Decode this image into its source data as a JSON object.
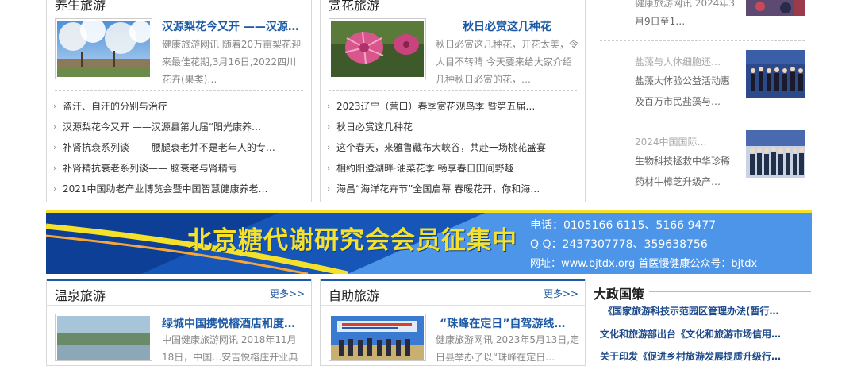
{
  "left_top": {
    "title": "养生旅游",
    "feature": {
      "title": "汉源梨花今又开 ——汉源…",
      "desc": "健康旅游网讯 随着20万亩梨花迎来最佳花期,3月16日,2022四川花卉(果类)…"
    },
    "list": [
      "盗汗、自汗的分别与治疗",
      "汉源梨花今又开 ——汉源县第九届“阳光康养…",
      "补肾抗衰系列谈—— 腰腿衰老并不是老年人的专…",
      "补肾精抗衰老系列谈—— 脑衰老与肾精亏",
      "2021中国助老产业博览会暨中国智慧健康养老…"
    ]
  },
  "mid_top": {
    "title": "赏花旅游",
    "feature": {
      "title": "秋日必赏这几种花",
      "desc": "秋日必赏这几种花，开花太美，令人目不转睛 今天要来给大家介绍几种秋日必赏的花，…"
    },
    "list": [
      "2023辽宁（营口）春季赏花观鸟季 暨第五届…",
      "秋日必赏这几种花",
      "这个春天，来雅鲁藏布大峡谷，共赴一场桃花盛宴",
      "相约阳澄湖畔·油菜花季 畅享春日田间野趣",
      "海昌“海洋花卉节”全国启幕 春暖花开，你和海…"
    ]
  },
  "right_col": {
    "top_text_1": "健康旅游网讯 2024年3",
    "top_text_2": "月9日至1…",
    "items": [
      {
        "gray": "盐藻与人体细胞还…",
        "line1": "盐藻大体验公益活动惠",
        "line2": "及百万市民盐藻与…"
      },
      {
        "gray": "2024中国国际…",
        "line1": "生物科技拯救中华珍稀",
        "line2": "药材牛樟芝升级产…"
      }
    ]
  },
  "banner": {
    "headline": "北京糖代谢研究会会员征集中",
    "phone": "电话：0105166 6115、5166 9477",
    "qq": "Q Q：2437307778、359638756",
    "web": "网址：www.bjtdx.org  首医慢健康公众号：bjtdx"
  },
  "left_bottom": {
    "title": "温泉旅游",
    "more": "更多>>",
    "feature": {
      "title": "绿城中国携悦榕酒店和度…",
      "desc": "中国健康旅游网讯 2018年11月18日，中国…安吉悦榕庄开业典礼及…"
    }
  },
  "mid_bottom": {
    "title": "自助旅游",
    "more": "更多>>",
    "feature": {
      "title": "“珠峰在定日”自驾游线…",
      "desc": "健康旅游网讯 2023年5月13日,定日县举办了以“珠峰在定日…"
    }
  },
  "policy": {
    "title": "大政国策",
    "items": [
      "《国家旅游科技示范园区管理办法(暂行…",
      "文化和旅游部出台《文化和旅游市场信用…",
      "关于印发《促进乡村旅游发展提质升级行…"
    ]
  },
  "colors": {
    "accent": "#1d5aa6",
    "banner_yellow": "#f5e12a"
  }
}
